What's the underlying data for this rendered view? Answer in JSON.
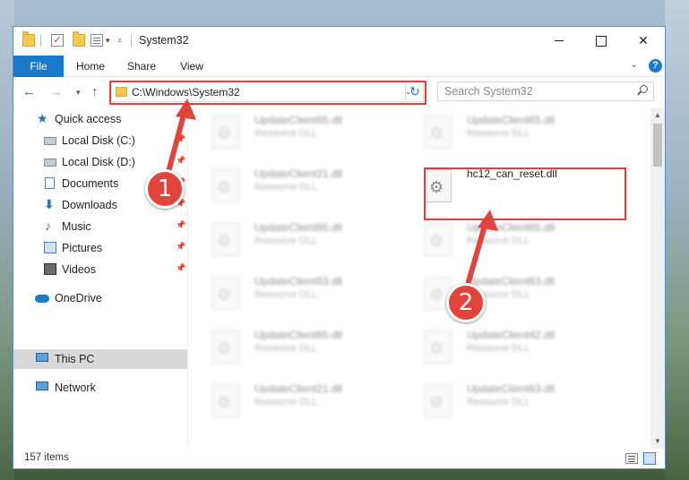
{
  "window": {
    "title": "System32",
    "close_glyph": "✕"
  },
  "ribbon": {
    "tabs": [
      "File",
      "Home",
      "Share",
      "View"
    ],
    "help_glyph": "?",
    "collapse_glyph": "⌄"
  },
  "navbar": {
    "back_glyph": "←",
    "forward_glyph": "→",
    "up_glyph": "↑",
    "recent_glyph": "▾",
    "address": "C:\\Windows\\System32",
    "address_chevron": "⌄",
    "refresh_glyph": "↻",
    "search_placeholder": "Search System32"
  },
  "sidebar": {
    "items": [
      {
        "label": "Quick access",
        "icon": "star-icon",
        "pinned": false
      },
      {
        "label": "Local Disk (C:)",
        "icon": "drive-icon",
        "pinned": true
      },
      {
        "label": "Local Disk (D:)",
        "icon": "drive-icon",
        "pinned": true
      },
      {
        "label": "Documents",
        "icon": "documents-icon",
        "pinned": true
      },
      {
        "label": "Downloads",
        "icon": "download-arrow-icon",
        "pinned": true
      },
      {
        "label": "Music",
        "icon": "music-note-icon",
        "pinned": true
      },
      {
        "label": "Pictures",
        "icon": "pictures-icon",
        "pinned": true
      },
      {
        "label": "Videos",
        "icon": "video-icon",
        "pinned": true
      },
      {
        "label": "OneDrive",
        "icon": "cloud-icon",
        "pinned": false
      },
      {
        "label": "This PC",
        "icon": "computer-icon",
        "pinned": false,
        "selected": true
      },
      {
        "label": "Network",
        "icon": "network-icon",
        "pinned": false
      }
    ],
    "pin_glyph": "📌"
  },
  "files": [
    {
      "name": "UpdateClient65.dll",
      "type": "Resource DLL",
      "highlighted": false
    },
    {
      "name": "UpdateClient65.dll",
      "type": "Resource DLL",
      "highlighted": false
    },
    {
      "name": "UpdateClient21.dll",
      "type": "Resource DLL",
      "highlighted": false
    },
    {
      "name": "hc12_can_reset.dll",
      "type": "",
      "highlighted": true
    },
    {
      "name": "UpdateClient65.dll",
      "type": "Resource DLL",
      "highlighted": false
    },
    {
      "name": "UpdateClient65.dll",
      "type": "Resource DLL",
      "highlighted": false
    },
    {
      "name": "UpdateClient63.dll",
      "type": "Resource DLL",
      "highlighted": false
    },
    {
      "name": "UpdateClient63.dll",
      "type": "Resource DLL",
      "highlighted": false
    },
    {
      "name": "UpdateClient65.dll",
      "type": "Resource DLL",
      "highlighted": false
    },
    {
      "name": "UpdateClient42.dll",
      "type": "Resource DLL",
      "highlighted": false
    },
    {
      "name": "UpdateClient21.dll",
      "type": "Resource DLL",
      "highlighted": false
    },
    {
      "name": "UpdateClient63.dll",
      "type": "Resource DLL",
      "highlighted": false
    }
  ],
  "status": {
    "item_count": "157 items"
  },
  "annotations": {
    "step1": "1",
    "step2": "2",
    "color": "#e0453d"
  }
}
